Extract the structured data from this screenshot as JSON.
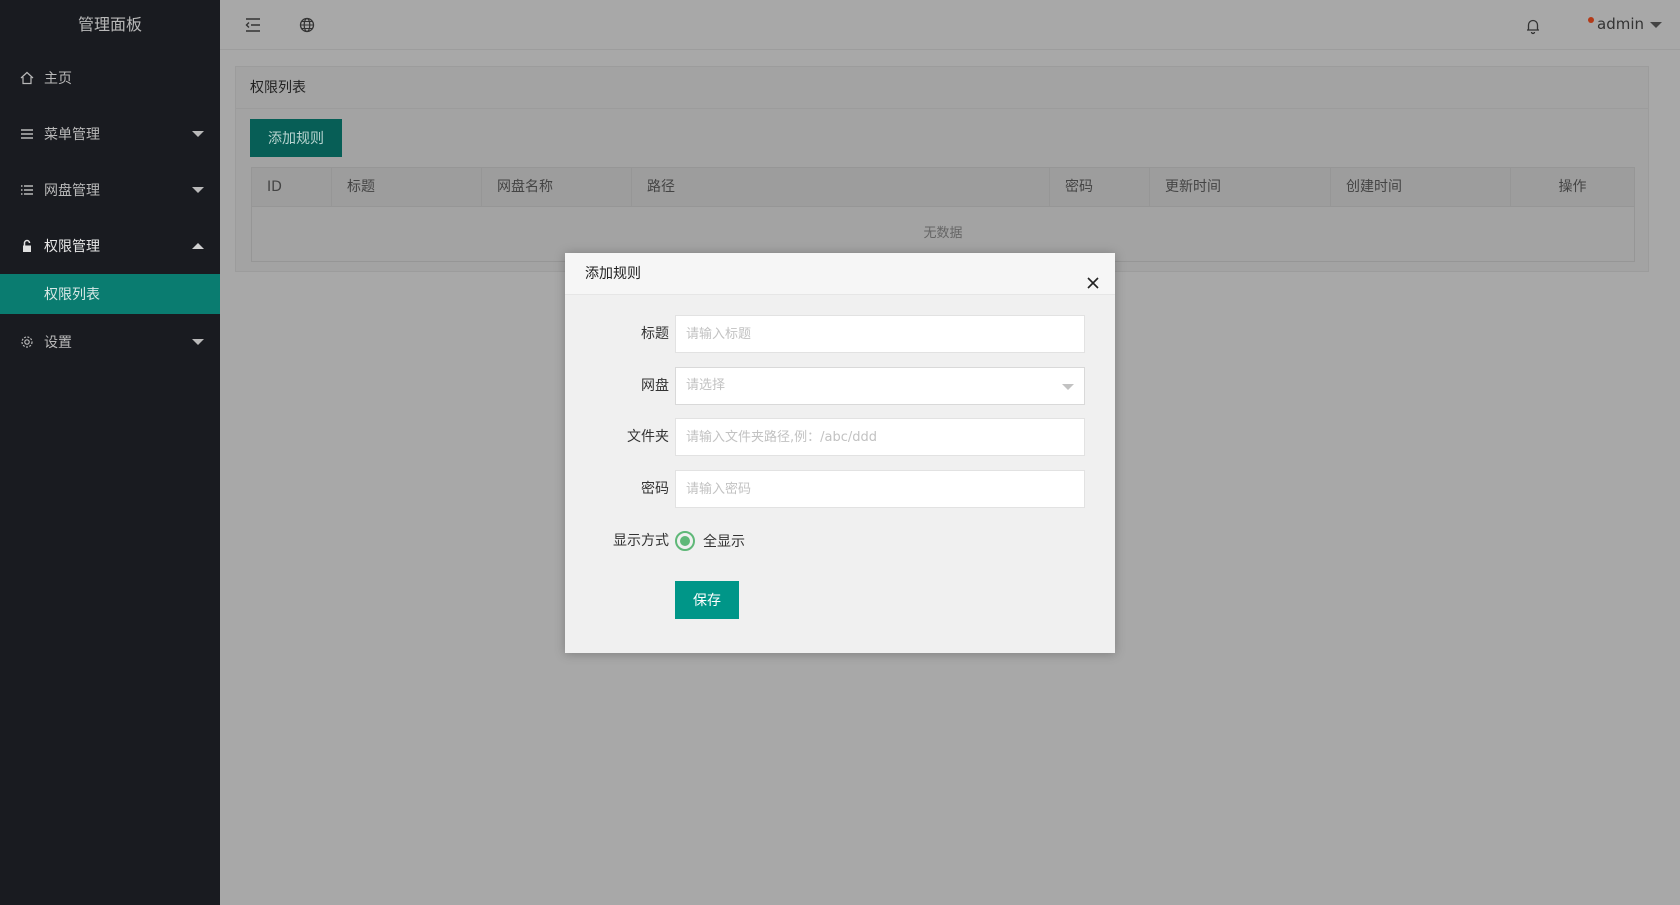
{
  "colors": {
    "sidebar_bg": "#191b20",
    "accent": "#009688",
    "notification_dot": "#b33a18"
  },
  "sidebar": {
    "brand": "管理面板",
    "items": [
      {
        "label": "主页",
        "icon": "home-icon"
      },
      {
        "label": "菜单管理",
        "icon": "menu-icon"
      },
      {
        "label": "网盘管理",
        "icon": "list-icon"
      },
      {
        "label": "权限管理",
        "icon": "lock-icon",
        "children": [
          {
            "label": "权限列表"
          }
        ]
      },
      {
        "label": "设置",
        "icon": "gear-icon"
      }
    ]
  },
  "header": {
    "user": "admin"
  },
  "panel": {
    "title": "权限列表",
    "add_button": "添加规则",
    "table": {
      "columns": [
        "ID",
        "标题",
        "网盘名称",
        "路径",
        "密码",
        "更新时间",
        "创建时间",
        "操作"
      ],
      "empty_text": "无数据"
    }
  },
  "modal": {
    "title": "添加规则",
    "fields": {
      "title": {
        "label": "标题",
        "placeholder": "请输入标题"
      },
      "drive": {
        "label": "网盘",
        "placeholder": "请选择"
      },
      "folder": {
        "label": "文件夹",
        "placeholder": "请输入文件夹路径,例：/abc/ddd"
      },
      "password": {
        "label": "密码",
        "placeholder": "请输入密码"
      },
      "display": {
        "label": "显示方式",
        "option": "全显示"
      }
    },
    "save_button": "保存"
  }
}
